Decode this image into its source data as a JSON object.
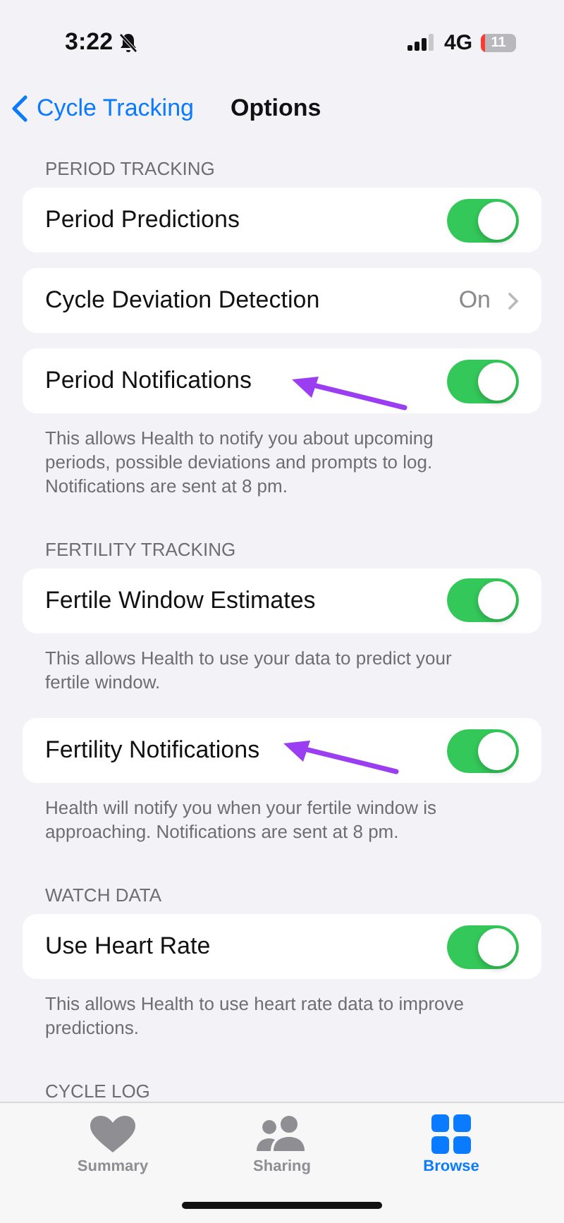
{
  "status_bar": {
    "time": "3:22",
    "network": "4G",
    "battery": "11"
  },
  "nav": {
    "back": "Cycle Tracking",
    "title": "Options"
  },
  "sections": [
    {
      "header": "PERIOD TRACKING",
      "groups": [
        {
          "rows": [
            {
              "kind": "toggle",
              "label": "Period Predictions",
              "on": true
            }
          ]
        },
        {
          "rows": [
            {
              "kind": "detail",
              "label": "Cycle Deviation Detection",
              "value": "On"
            }
          ]
        },
        {
          "rows": [
            {
              "kind": "toggle",
              "label": "Period Notifications",
              "on": true
            }
          ],
          "footer": "This allows Health to notify you about upcoming periods, possible deviations and prompts to log. Notifications are sent at 8 pm."
        }
      ]
    },
    {
      "header": "FERTILITY TRACKING",
      "groups": [
        {
          "rows": [
            {
              "kind": "toggle",
              "label": "Fertile Window Estimates",
              "on": true
            }
          ],
          "footer": "This allows Health to use your data to predict your fertile window."
        },
        {
          "rows": [
            {
              "kind": "toggle",
              "label": "Fertility Notifications",
              "on": true
            }
          ],
          "footer": "Health will notify you when your fertile window is approaching. Notifications are sent at 8 pm."
        }
      ]
    },
    {
      "header": "WATCH DATA",
      "groups": [
        {
          "rows": [
            {
              "kind": "toggle",
              "label": "Use Heart Rate",
              "on": true
            }
          ],
          "footer": "This allows Health to use heart rate data to improve predictions."
        }
      ]
    },
    {
      "header": "CYCLE LOG"
    }
  ],
  "tabs": [
    {
      "label": "Summary",
      "selected": false
    },
    {
      "label": "Sharing",
      "selected": false
    },
    {
      "label": "Browse",
      "selected": true
    }
  ]
}
